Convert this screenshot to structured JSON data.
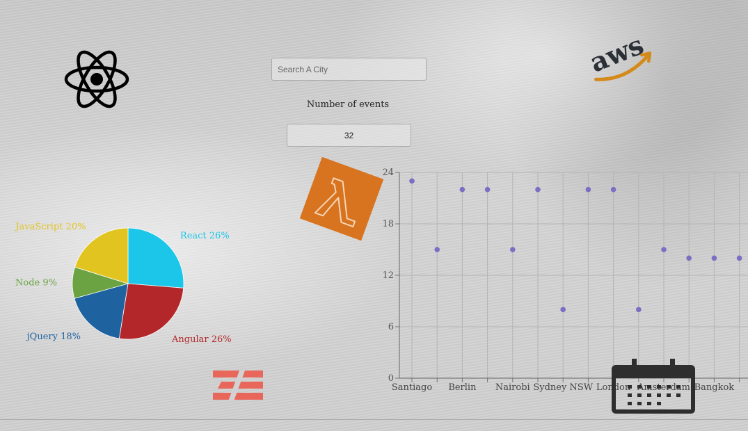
{
  "search": {
    "placeholder": "Search A City",
    "value": ""
  },
  "events": {
    "label": "Number of events",
    "value": "32"
  },
  "icons": {
    "react": "react-atom-icon",
    "aws": "aws-logo-icon",
    "lambda": "aws-lambda-icon",
    "zeit": "stripes-logo-icon",
    "calendar": "calendar-icon"
  },
  "colors": {
    "react": "#1cc6e8",
    "angular": "#b3272a",
    "jquery": "#1e629f",
    "node": "#6ba342",
    "javascript": "#e2c420",
    "scatter_point": "#7b6fc4",
    "lambda_orange": "#d8731f",
    "aws_orange": "#d48a1a",
    "zeit_red": "#e8665a"
  },
  "chart_data": [
    {
      "type": "pie",
      "slices": [
        {
          "label": "React 26%",
          "value": 26,
          "color": "#1cc6e8"
        },
        {
          "label": "Angular 26%",
          "value": 26,
          "color": "#b3272a"
        },
        {
          "label": "jQuery 18%",
          "value": 18,
          "color": "#1e629f"
        },
        {
          "label": "Node 9%",
          "value": 9,
          "color": "#6ba342"
        },
        {
          "label": "JavaScript 20%",
          "value": 20,
          "color": "#e2c420"
        }
      ]
    },
    {
      "type": "scatter",
      "categories": [
        "Santiago",
        "",
        "Berlin",
        "",
        "Nairobi",
        "",
        "Sydney NSW",
        "",
        "London",
        "",
        "Amsterdam",
        "",
        "Bangkok",
        ""
      ],
      "x_tick_labels": [
        "Santiago",
        "Berlin",
        "Nairobi",
        "Sydney NSW",
        "London",
        "Amsterdam",
        "Bangkok"
      ],
      "values": [
        23,
        15,
        22,
        22,
        15,
        22,
        8,
        22,
        22,
        8,
        15,
        14,
        14,
        14
      ],
      "y_ticks": [
        "0",
        "6",
        "12",
        "18",
        "24"
      ],
      "ylim": [
        0,
        24
      ],
      "grid": true,
      "point_color": "#7b6fc4"
    }
  ]
}
